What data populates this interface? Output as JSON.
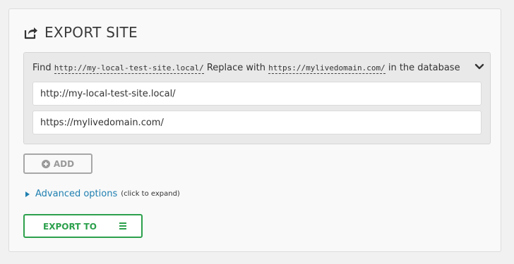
{
  "header": {
    "title": "EXPORT SITE",
    "icon": "export-icon"
  },
  "replace": {
    "find_prefix": "Find",
    "find_value": "http://my-local-test-site.local/",
    "replace_prefix": "Replace with",
    "replace_value": "https://mylivedomain.com/",
    "suffix": "in the database",
    "find_field_value": "http://my-local-test-site.local/",
    "replace_field_value": "https://mylivedomain.com/"
  },
  "buttons": {
    "add_label": "ADD",
    "export_label": "EXPORT TO"
  },
  "advanced": {
    "link_label": "Advanced options",
    "hint": "(click to expand)"
  },
  "colors": {
    "accent_green": "#2ca04c",
    "link_blue": "#1e7fb0",
    "disabled_gray": "#a7a7a7"
  }
}
